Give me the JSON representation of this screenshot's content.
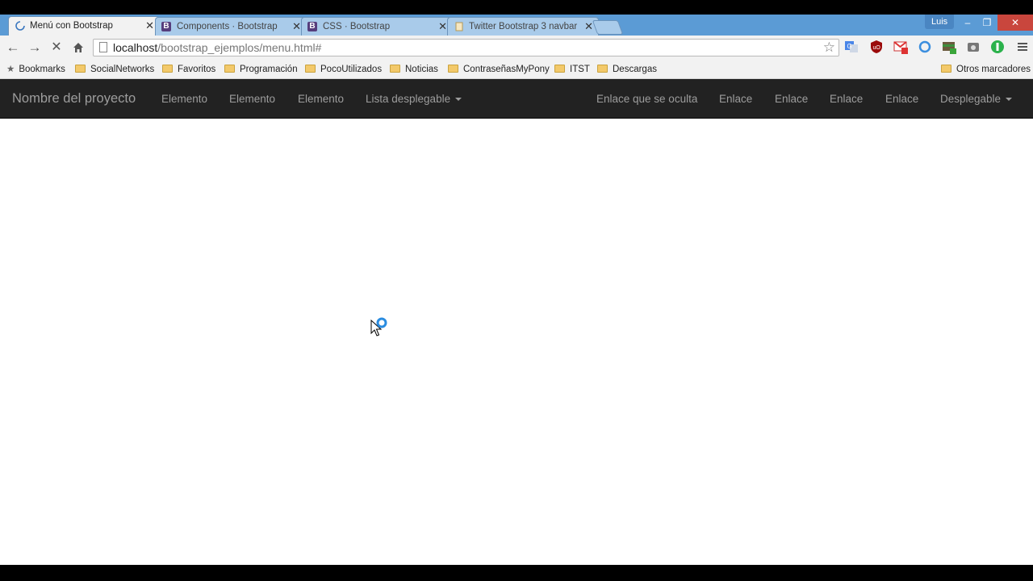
{
  "browser": {
    "tabs": [
      {
        "title": "Menú con Bootstrap",
        "active": true,
        "icon": "loading-spinner-icon"
      },
      {
        "title": "Components · Bootstrap",
        "active": false,
        "icon": "bootstrap-icon"
      },
      {
        "title": "CSS · Bootstrap",
        "active": false,
        "icon": "bootstrap-icon"
      },
      {
        "title": "Twitter Bootstrap 3 navbar",
        "active": false,
        "icon": "page-icon"
      }
    ],
    "user": "Luis",
    "window_controls": {
      "minimize": "–",
      "restore": "❐",
      "close": "✕"
    },
    "url_host": "localhost",
    "url_path": "/bootstrap_ejemplos/menu.html#",
    "bookmarks": [
      {
        "label": "Bookmarks",
        "icon": "star-icon"
      },
      {
        "label": "SocialNetworks",
        "icon": "folder-icon"
      },
      {
        "label": "Favoritos",
        "icon": "folder-icon"
      },
      {
        "label": "Programación",
        "icon": "folder-icon"
      },
      {
        "label": "PocoUtilizados",
        "icon": "folder-icon"
      },
      {
        "label": "Noticias",
        "icon": "folder-icon"
      },
      {
        "label": "ContraseñasMyPony",
        "icon": "folder-icon"
      },
      {
        "label": "ITST",
        "icon": "folder-icon"
      },
      {
        "label": "Descargas",
        "icon": "folder-icon"
      }
    ],
    "other_bookmarks": "Otros marcadores",
    "colors": {
      "tabstrip": "#5b9bd5",
      "toolbar": "#f2f2f2"
    }
  },
  "page": {
    "navbar": {
      "brand": "Nombre del proyecto",
      "left_items": [
        "Elemento",
        "Elemento",
        "Elemento",
        "Lista desplegable"
      ],
      "right_items": [
        "Enlace que se oculta",
        "Enlace",
        "Enlace",
        "Enlace",
        "Enlace",
        "Desplegable"
      ],
      "colors": {
        "background": "#222222",
        "text": "#9d9d9d"
      }
    }
  }
}
